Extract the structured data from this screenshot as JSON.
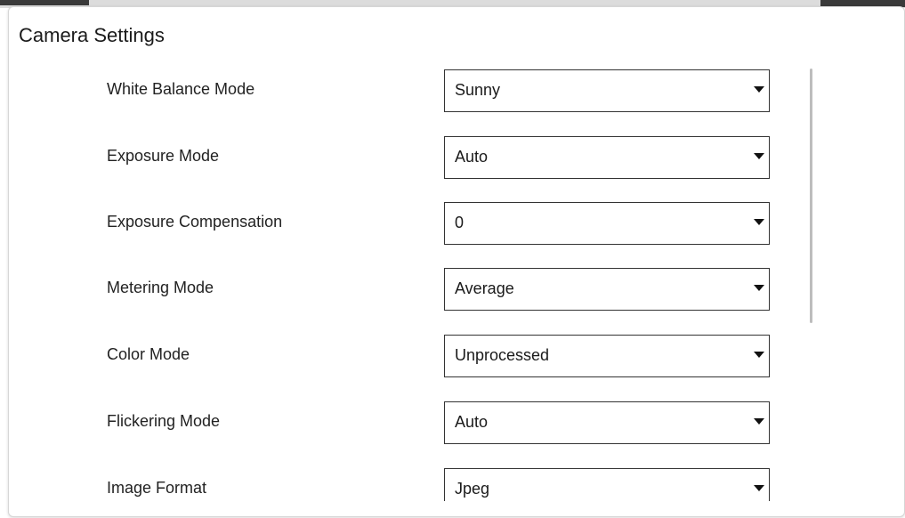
{
  "dialog": {
    "title": "Camera Settings"
  },
  "settings": [
    {
      "label": "White Balance Mode",
      "value": "Sunny"
    },
    {
      "label": "Exposure Mode",
      "value": "Auto"
    },
    {
      "label": "Exposure Compensation",
      "value": "0"
    },
    {
      "label": "Metering Mode",
      "value": "Average"
    },
    {
      "label": "Color Mode",
      "value": "Unprocessed"
    },
    {
      "label": "Flickering Mode",
      "value": "Auto"
    },
    {
      "label": "Image Format",
      "value": "Jpeg"
    }
  ],
  "icons": {
    "dropdown": "caret-down-icon"
  }
}
